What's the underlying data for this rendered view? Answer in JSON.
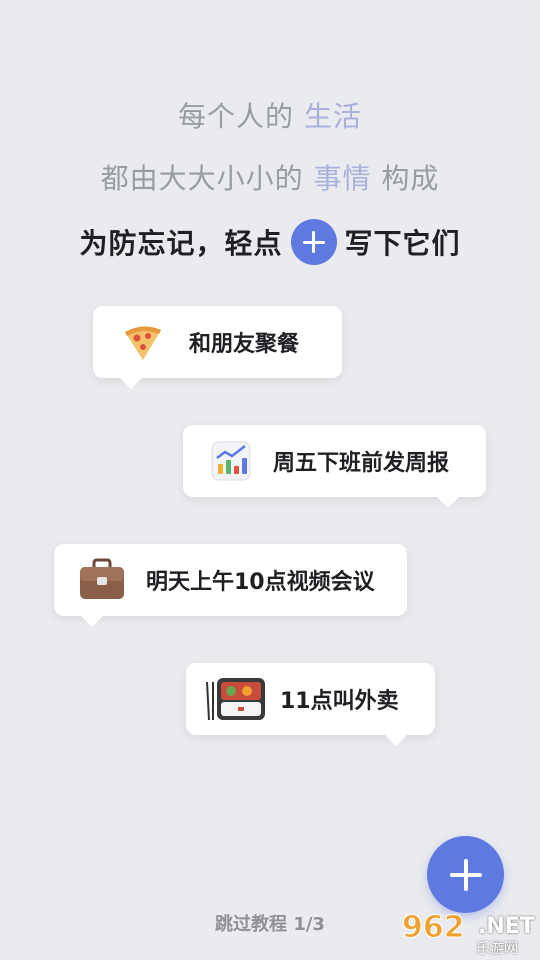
{
  "intro": {
    "line1_prefix": "每个人的 ",
    "line1_highlight": "生活",
    "line2_prefix": "都由大大小小的 ",
    "line2_highlight": "事情",
    "line2_suffix": " 构成",
    "line3_prefix": "为防忘记，轻点",
    "line3_suffix": "写下它们"
  },
  "bubbles": [
    {
      "icon": "pizza-icon",
      "text": "和朋友聚餐"
    },
    {
      "icon": "chart-icon",
      "text": "周五下班前发周报"
    },
    {
      "icon": "briefcase-icon",
      "text": "明天上午10点视频会议"
    },
    {
      "icon": "bento-icon",
      "text": "11点叫外卖"
    }
  ],
  "skip": {
    "label": "跳过教程 1/3"
  },
  "watermark": {
    "main": "962",
    "net": ".NET",
    "sub": "乐游网"
  },
  "colors": {
    "accent": "#5e79e0",
    "highlight": "#a8b0de",
    "background": "#eaebee"
  }
}
